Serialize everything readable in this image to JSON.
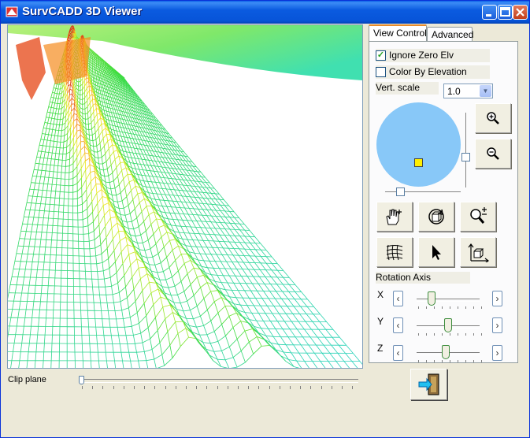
{
  "window": {
    "title": "SurvCADD 3D Viewer"
  },
  "viewport": {
    "description_icon": "terrain-wireframe"
  },
  "clip_plane": {
    "label": "Clip plane",
    "value": 0
  },
  "tabs": [
    {
      "label": "View Control",
      "active": true
    },
    {
      "label": "Advanced",
      "active": false
    }
  ],
  "options": {
    "ignore_zero_elv": {
      "label": "Ignore Zero Elv",
      "checked": true
    },
    "color_by_elevation": {
      "label": "Color By Elevation",
      "checked": false
    }
  },
  "vert_scale": {
    "label": "Vert. scale",
    "value": "1.0"
  },
  "tools": [
    "zoom-in-icon",
    "zoom-out-icon",
    "pan-icon",
    "rotate-icon",
    "zoom-window-icon",
    "mesh-icon",
    "select-arrow-icon",
    "axis-move-icon"
  ],
  "rotation": {
    "title": "Rotation Axis",
    "axes": [
      {
        "label": "X",
        "value": 0.2
      },
      {
        "label": "Y",
        "value": 0.5
      },
      {
        "label": "Z",
        "value": 0.45
      }
    ]
  },
  "colors": {
    "title_bar": "#0b5be0",
    "nav_circle": "#88c8f8",
    "marker": "#ffef00"
  }
}
